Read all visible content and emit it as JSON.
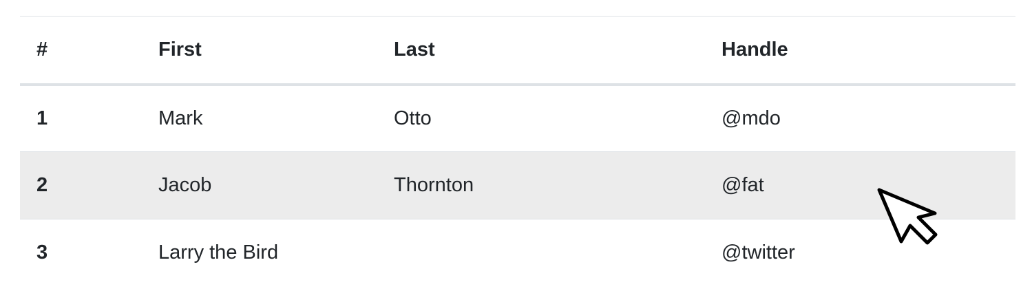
{
  "table": {
    "headers": [
      "#",
      "First",
      "Last",
      "Handle"
    ],
    "rows": [
      {
        "num": "1",
        "first": "Mark",
        "last": "Otto",
        "handle": "@mdo"
      },
      {
        "num": "2",
        "first": "Jacob",
        "last": "Thornton",
        "handle": "@fat"
      },
      {
        "num": "3",
        "first": "Larry the Bird",
        "last": "",
        "handle": "@twitter"
      }
    ],
    "hovered_row": "2"
  },
  "cursor": {
    "icon": "mouse-pointer-icon"
  },
  "colors": {
    "text": "#212529",
    "border": "#dee2e6",
    "row_hover": "#ececec"
  }
}
